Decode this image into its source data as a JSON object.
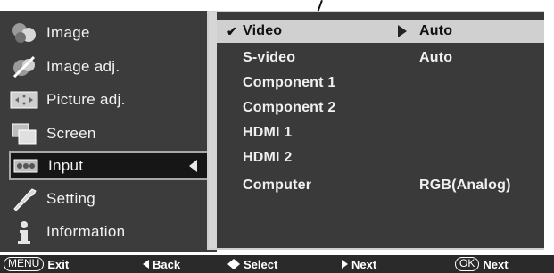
{
  "left_menu": {
    "items": [
      {
        "label": "Image",
        "icon": "image-icon"
      },
      {
        "label": "Image adj.",
        "icon": "image-adjust-icon"
      },
      {
        "label": "Picture adj.",
        "icon": "picture-adjust-icon"
      },
      {
        "label": "Screen",
        "icon": "screen-icon"
      },
      {
        "label": "Input",
        "icon": "input-icon",
        "selected": true
      },
      {
        "label": "Setting",
        "icon": "setting-icon"
      },
      {
        "label": "Information",
        "icon": "information-icon"
      }
    ]
  },
  "input_menu": {
    "rows": [
      {
        "label": "Video",
        "value": "Auto",
        "selected": true
      },
      {
        "label": "S-video",
        "value": "Auto"
      },
      {
        "label": "Component 1",
        "value": ""
      },
      {
        "label": "Component 2",
        "value": ""
      },
      {
        "label": "HDMI 1",
        "value": ""
      },
      {
        "label": "HDMI 2",
        "value": ""
      },
      {
        "label": "Computer",
        "value": "RGB(Analog)"
      }
    ]
  },
  "bottom_bar": {
    "menu_key": "MENU",
    "exit_label": "Exit",
    "back_label": "Back",
    "select_label": "Select",
    "next_label": "Next",
    "ok_key": "OK",
    "ok_next_label": "Next"
  },
  "colors": {
    "menu_bg": "#3c3c3c",
    "panel_bg": "#3a3a3a",
    "highlight": "#d0d0d0",
    "text": "#f0f0f0"
  }
}
